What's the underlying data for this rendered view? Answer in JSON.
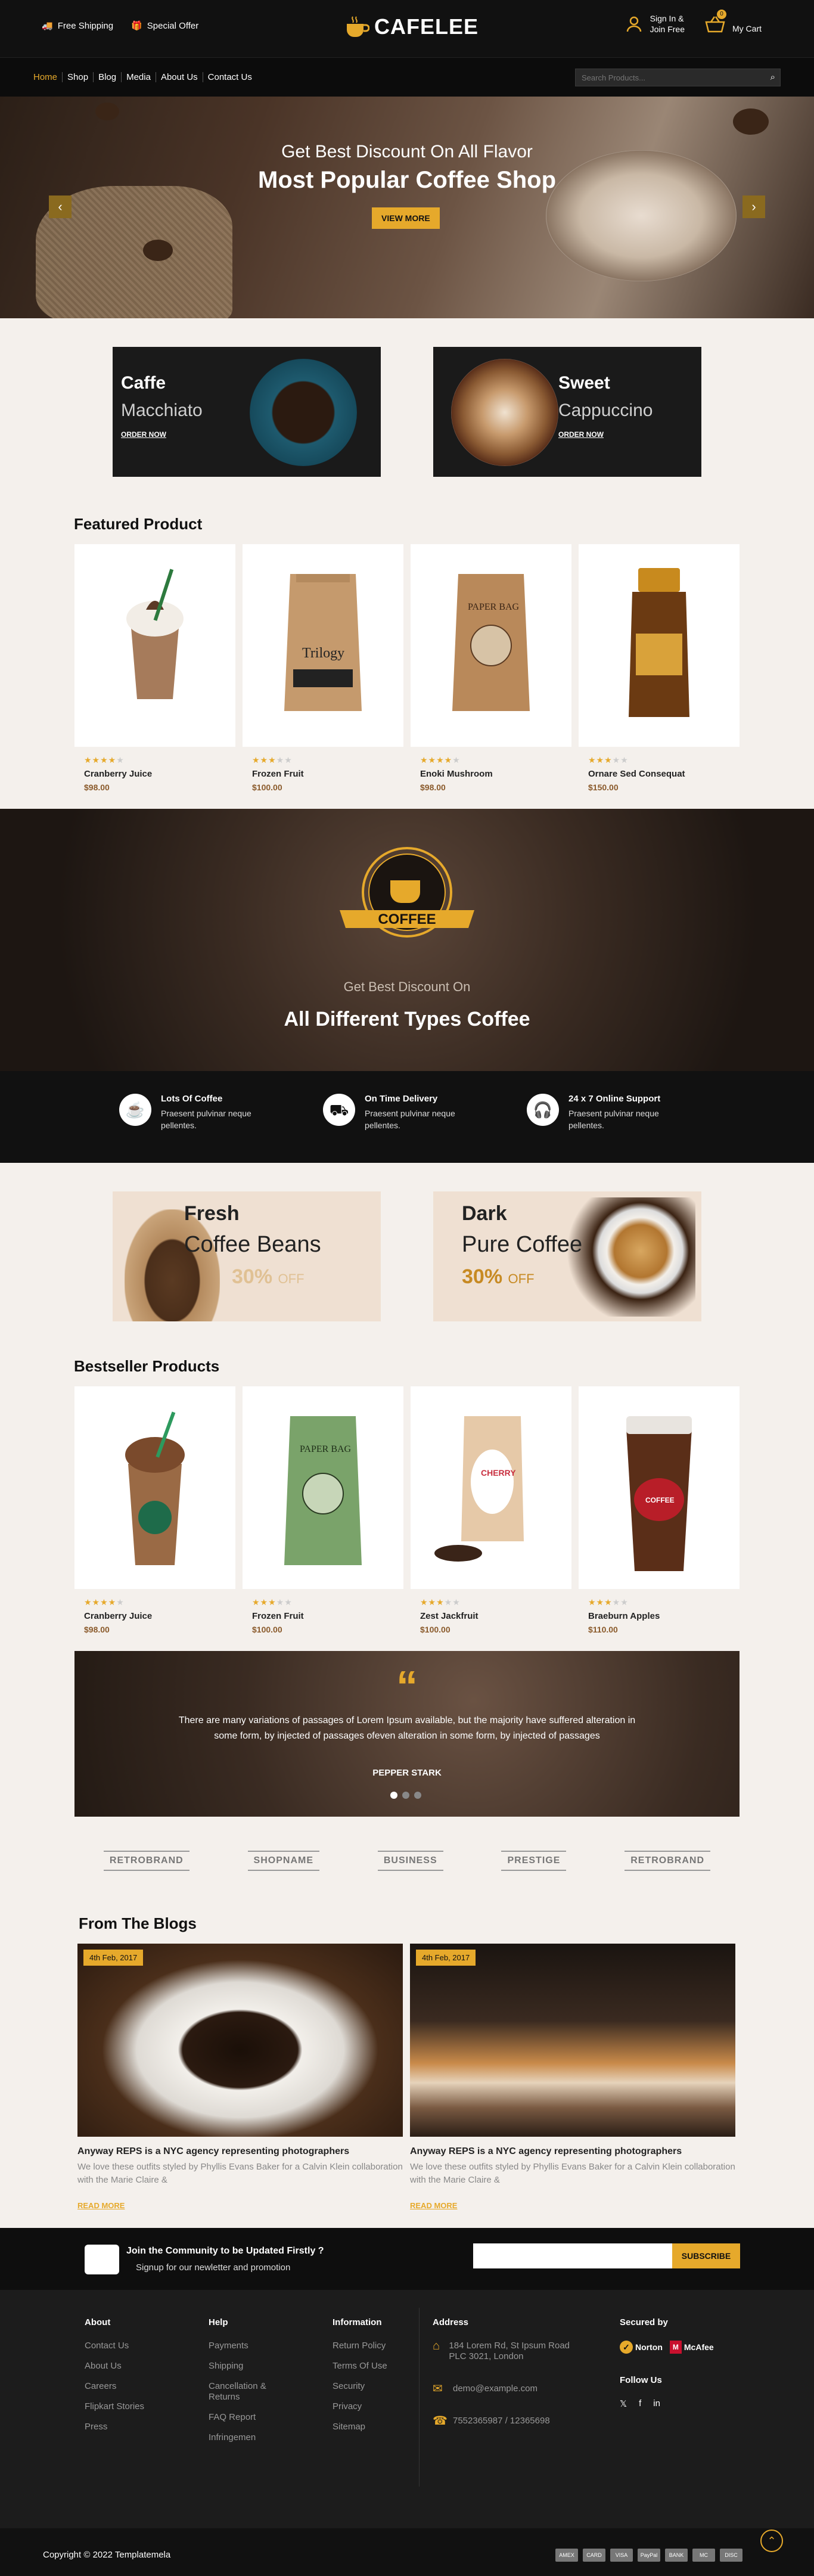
{
  "topbar": {
    "free_shipping": "Free Shipping",
    "special_offer": "Special Offer",
    "logo": "CAFELEE",
    "signin": "Sign In &",
    "join": "Join Free",
    "cart_count": "0",
    "cart": "My Cart"
  },
  "nav": {
    "items": [
      "Home",
      "Shop",
      "Blog",
      "Media",
      "About Us",
      "Contact Us"
    ],
    "search_placeholder": "Search Products..."
  },
  "hero": {
    "subtitle": "Get Best Discount On All Flavor",
    "title": "Most Popular Coffee Shop",
    "button": "VIEW MORE",
    "prev": "‹",
    "next": "›"
  },
  "promo": [
    {
      "title": "Caffe",
      "sub": "Macchiato",
      "link": "ORDER NOW"
    },
    {
      "title": "Sweet",
      "sub": "Cappuccino",
      "link": "ORDER NOW"
    }
  ],
  "featured": {
    "title": "Featured Product",
    "items": [
      {
        "name": "Cranberry Juice",
        "price": "$98.00",
        "stars": 4
      },
      {
        "name": "Frozen Fruit",
        "price": "$100.00",
        "stars": 3
      },
      {
        "name": "Enoki Mushroom",
        "price": "$98.00",
        "stars": 4
      },
      {
        "name": "Ornare Sed Consequat",
        "price": "$150.00",
        "stars": 3
      }
    ]
  },
  "coffee_banner": {
    "emblem": "COFFEE",
    "subtitle": "Get Best Discount On",
    "title": "All Different Types Coffee"
  },
  "features": [
    {
      "title": "Lots Of Coffee",
      "text": "Praesent pulvinar neque pellentes."
    },
    {
      "title": "On Time Delivery",
      "text": "Praesent pulvinar neque pellentes."
    },
    {
      "title": "24 x 7 Online Support",
      "text": "Praesent pulvinar neque pellentes."
    }
  ],
  "promo2": [
    {
      "title": "Fresh",
      "sub": "Coffee Beans",
      "off": "30%",
      "off_label": "OFF"
    },
    {
      "title": "Dark",
      "sub": "Pure Coffee",
      "off": "30%",
      "off_label": "OFF"
    }
  ],
  "bestseller": {
    "title": "Bestseller Products",
    "items": [
      {
        "name": "Cranberry Juice",
        "price": "$98.00",
        "stars": 4
      },
      {
        "name": "Frozen Fruit",
        "price": "$100.00",
        "stars": 3
      },
      {
        "name": "Zest Jackfruit",
        "price": "$100.00",
        "stars": 3
      },
      {
        "name": "Braeburn Apples",
        "price": "$110.00",
        "stars": 3
      }
    ]
  },
  "testimonial": {
    "quote_mark": "“",
    "text": "There are many variations of passages of Lorem Ipsum available, but the majority have suffered alteration in some form, by injected of passages ofeven alteration in some form, by injected of passages",
    "author": "PEPPER STARK"
  },
  "brands": [
    "RETROBRAND",
    "SHOPNAME",
    "BUSINESS",
    "PRESTIGE",
    "RETROBRAND"
  ],
  "blogs": {
    "title": "From The Blogs",
    "items": [
      {
        "date": "4th Feb, 2017",
        "title": "Anyway REPS is a NYC agency representing photographers",
        "text": "We love these outfits styled by Phyllis Evans Baker for a Calvin Klein collaboration with the Marie Claire &",
        "link": "READ MORE"
      },
      {
        "date": "4th Feb, 2017",
        "title": "Anyway REPS is a NYC agency representing photographers",
        "text": "We love these outfits styled by Phyllis Evans Baker for a Calvin Klein collaboration with the Marie Claire &",
        "link": "READ MORE"
      }
    ]
  },
  "newsletter": {
    "title": "Join the Community to be Updated Firstly ?",
    "text": "Signup for our newletter and promotion",
    "button": "SUBSCRIBE"
  },
  "footer": {
    "about": {
      "title": "About",
      "items": [
        "Contact Us",
        "About Us",
        "Careers",
        "Flipkart Stories",
        "Press"
      ]
    },
    "help": {
      "title": "Help",
      "items": [
        "Payments",
        "Shipping",
        "Cancellation & Returns",
        "FAQ Report",
        "Infringemen"
      ]
    },
    "info": {
      "title": "Information",
      "items": [
        "Return Policy",
        "Terms Of Use",
        "Security",
        "Privacy",
        "Sitemap"
      ]
    },
    "address": {
      "title": "Address",
      "line": "184 Lorem Rd, St Ipsum Road PLC 3021, London",
      "email": "demo@example.com",
      "phone": "7552365987 / 12365698"
    },
    "secured_by": "Secured by",
    "norton": "Norton",
    "mcafee": "McAfee",
    "follow": "Follow Us",
    "social": [
      "𝕏",
      "f",
      "in"
    ]
  },
  "copyright": "Copyright © 2022 Templatemela",
  "payments": [
    "AMEX",
    "CARD",
    "VISA",
    "PayPal",
    "BANK",
    "MC",
    "DISC"
  ]
}
